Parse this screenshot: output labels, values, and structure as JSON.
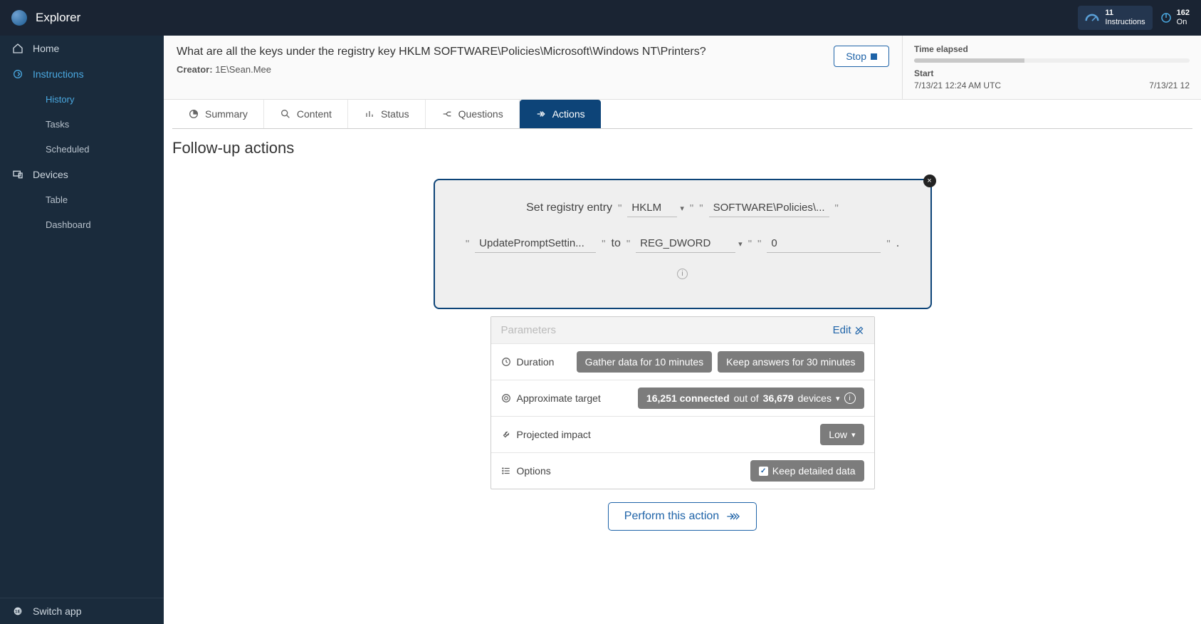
{
  "brand": "Explorer",
  "topbar": {
    "instructions_count": "11",
    "instructions_label": "Instructions",
    "online_count": "162",
    "online_label": "On"
  },
  "sidebar": {
    "home": "Home",
    "instructions": "Instructions",
    "history": "History",
    "tasks": "Tasks",
    "scheduled": "Scheduled",
    "devices": "Devices",
    "table": "Table",
    "dashboard": "Dashboard",
    "switch_app": "Switch app"
  },
  "header": {
    "question": "What are all the keys under the registry key HKLM SOFTWARE\\Policies\\Microsoft\\Windows NT\\Printers?",
    "creator_label": "Creator:",
    "creator_value": "1E\\Sean.Mee",
    "stop": "Stop"
  },
  "timing": {
    "elapsed_label": "Time elapsed",
    "start_label": "Start",
    "start_value": "7/13/21 12:24 AM UTC",
    "end_value": "7/13/21 12"
  },
  "tabs": {
    "summary": "Summary",
    "content": "Content",
    "status": "Status",
    "questions": "Questions",
    "actions": "Actions"
  },
  "section_title": "Follow-up actions",
  "action": {
    "verb": "Set registry entry",
    "hive": "HKLM",
    "path": "SOFTWARE\\Policies\\...",
    "name": "UpdatePromptSettin...",
    "to": "to",
    "type": "REG_DWORD",
    "value": "0"
  },
  "params": {
    "title": "Parameters",
    "edit": "Edit",
    "duration_label": "Duration",
    "gather": "Gather data for 10 minutes",
    "keep_answers": "Keep answers for 30 minutes",
    "target_label": "Approximate target",
    "target_connected": "16,251 connected",
    "target_outof": " out of ",
    "target_total": "36,679",
    "target_devices": " devices",
    "impact_label": "Projected impact",
    "impact_value": "Low",
    "options_label": "Options",
    "keep_detailed": "Keep detailed data"
  },
  "perform": "Perform this action"
}
